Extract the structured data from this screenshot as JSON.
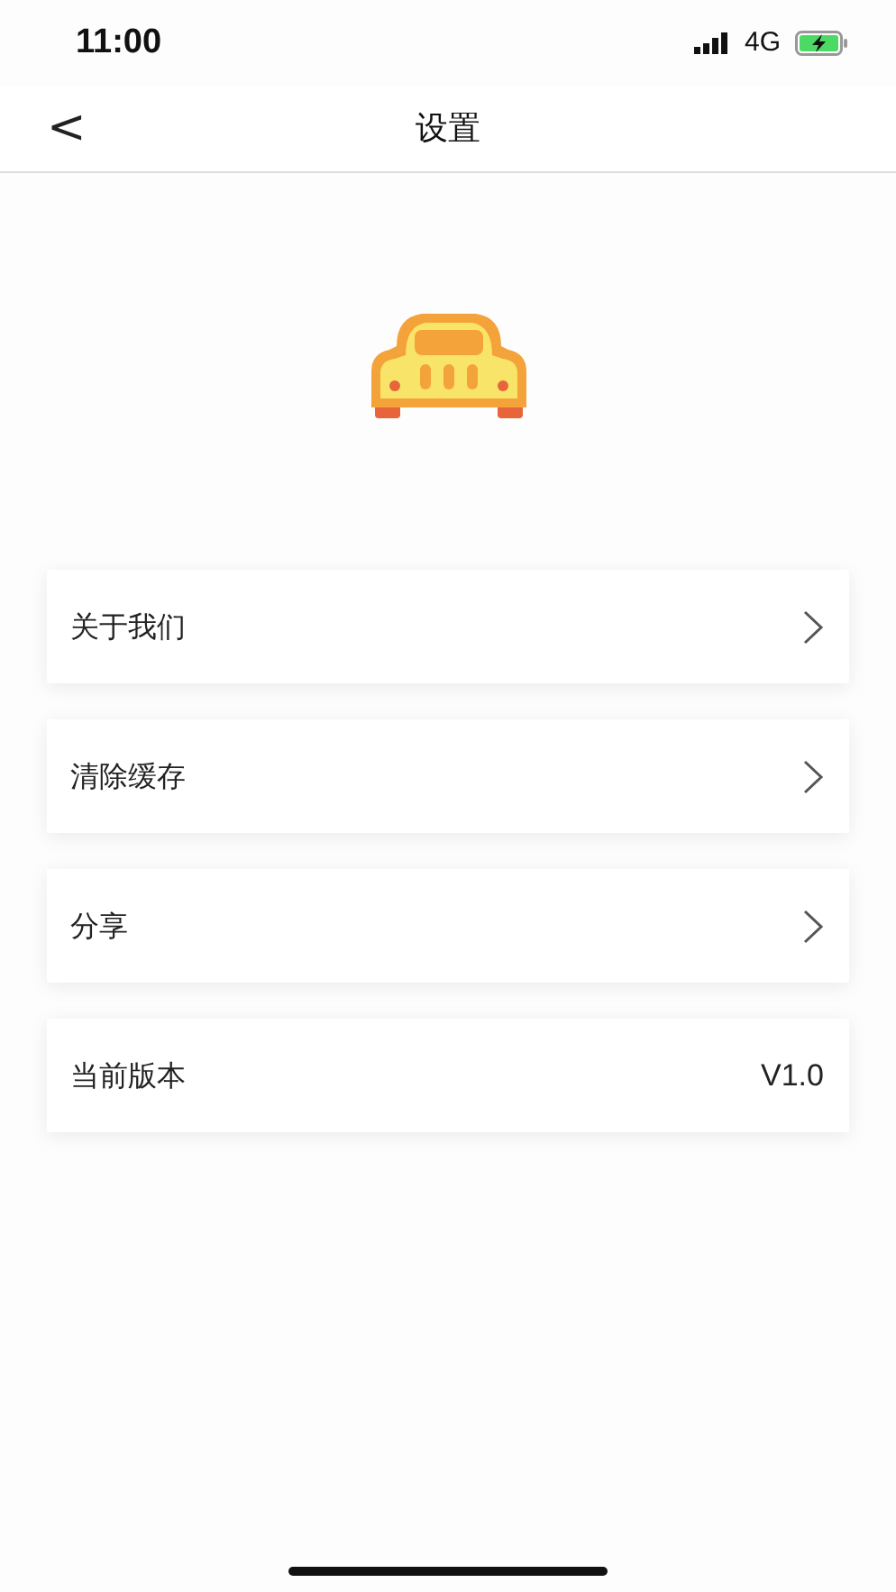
{
  "status_bar": {
    "time": "11:00",
    "network": "4G"
  },
  "nav": {
    "back": "<",
    "title": "设置"
  },
  "settings": [
    {
      "kind": "link",
      "label": "关于我们"
    },
    {
      "kind": "link",
      "label": "清除缓存"
    },
    {
      "kind": "link",
      "label": "分享"
    },
    {
      "kind": "value",
      "label": "当前版本",
      "value": "V1.0"
    }
  ]
}
